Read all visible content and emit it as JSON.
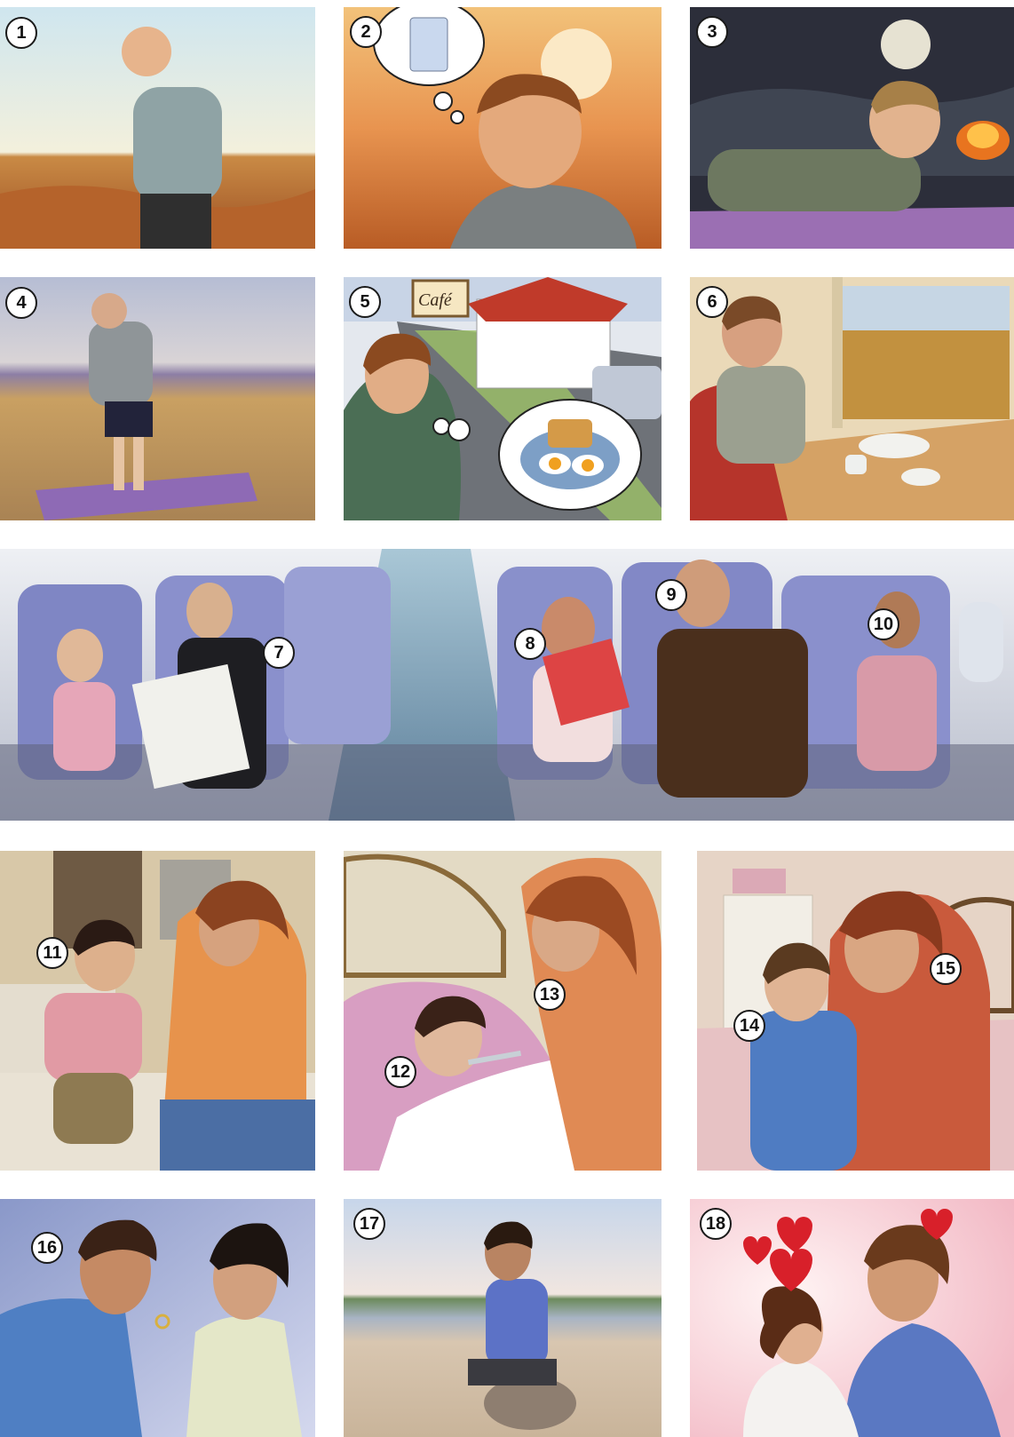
{
  "panels": [
    {
      "number": "1"
    },
    {
      "number": "2"
    },
    {
      "number": "3"
    },
    {
      "number": "4"
    },
    {
      "number": "5",
      "sign_text": "Café"
    },
    {
      "number": "6"
    },
    {
      "number": "7"
    },
    {
      "number": "8"
    },
    {
      "number": "9"
    },
    {
      "number": "10"
    },
    {
      "number": "11"
    },
    {
      "number": "12"
    },
    {
      "number": "13"
    },
    {
      "number": "14"
    },
    {
      "number": "15"
    },
    {
      "number": "16"
    },
    {
      "number": "17"
    },
    {
      "number": "18"
    }
  ],
  "colors": {
    "badge_border": "#1a1a1a",
    "desert": "#c9783a",
    "sunset": "#e8a060",
    "night": "#2c2e3a",
    "plane_seat": "#7f86c4",
    "heart": "#d8202a"
  }
}
